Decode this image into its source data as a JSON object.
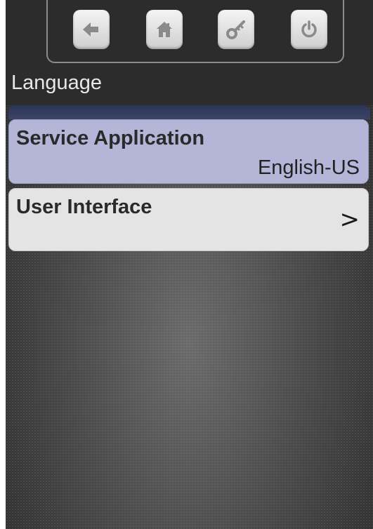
{
  "header": {
    "title": "Language"
  },
  "toolbar": {
    "buttons": [
      {
        "id": "back",
        "icon": "back-arrow-icon"
      },
      {
        "id": "home",
        "icon": "home-icon"
      },
      {
        "id": "key",
        "icon": "key-icon"
      },
      {
        "id": "power",
        "icon": "power-icon"
      }
    ]
  },
  "settings": {
    "items": [
      {
        "label": "Service Application",
        "value": "English-US",
        "selected": true
      },
      {
        "label": "User Interface",
        "chevron": ">",
        "selected": false
      }
    ]
  },
  "colors": {
    "selected_item_bg": "#b4b5d7",
    "item_bg": "#e4e4e4",
    "header_bg": "#2c2c2c",
    "title_text": "#e8e8e8"
  }
}
